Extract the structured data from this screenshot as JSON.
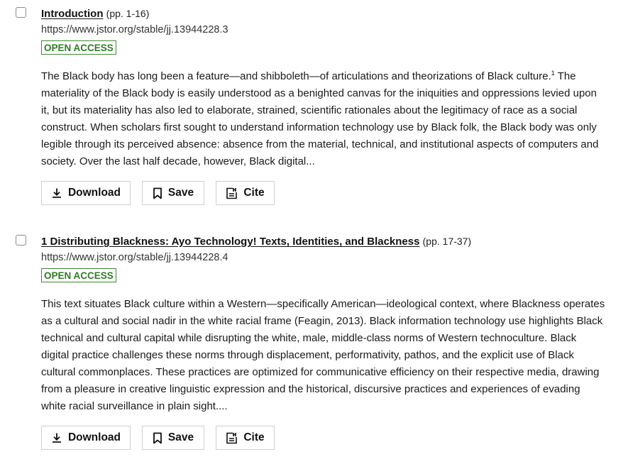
{
  "results": [
    {
      "title": "Introduction",
      "pages": "(pp. 1-16)",
      "url": "https://www.jstor.org/stable/jj.13944228.3",
      "badge": "OPEN ACCESS",
      "abstract_before_sup": "The Black body has long been a feature—and shibboleth—of articulations and theorizations of Black culture.",
      "abstract_sup": "1",
      "abstract_after_sup": " The materiality of the Black body is easily understood as a benighted canvas for the iniquities and oppressions levied upon it, but its materiality has also led to elaborate, strained, scientific rationales about the legitimacy of race as a social construct. When scholars first sought to understand information technology use by Black folk, the Black body was only legible through its perceived absence: absence from the material, technical, and institutional aspects of computers and society. Over the last half decade, however, Black digital...",
      "download_label": "Download",
      "save_label": "Save",
      "cite_label": "Cite"
    },
    {
      "title": "1 Distributing Blackness: Ayo Technology! Texts, Identities, and Blackness",
      "pages": "(pp. 17-37)",
      "url": "https://www.jstor.org/stable/jj.13944228.4",
      "badge": "OPEN ACCESS",
      "abstract": "This text situates Black culture within a Western—specifically American—ideological context, where Blackness operates as a cultural and social nadir in the white racial frame (Feagin, 2013). Black information technology use highlights Black technical and cultural capital while disrupting the white, male, middle-class norms of Western technoculture. Black digital practice challenges these norms through displacement, performativity, pathos, and the explicit use of Black cultural commonplaces. These practices are optimized for communicative efficiency on their respective media, drawing from a pleasure in creative linguistic expression and the historical, discursive practices and experiences of evading white racial surveillance in plain sight....",
      "download_label": "Download",
      "save_label": "Save",
      "cite_label": "Cite"
    }
  ],
  "icons": {
    "download": "download-icon",
    "save": "bookmark-icon",
    "cite": "cite-icon"
  },
  "colors": {
    "badge_border": "#3c8a2e",
    "badge_text": "#2e7d22",
    "button_border": "#cfcfcf"
  }
}
